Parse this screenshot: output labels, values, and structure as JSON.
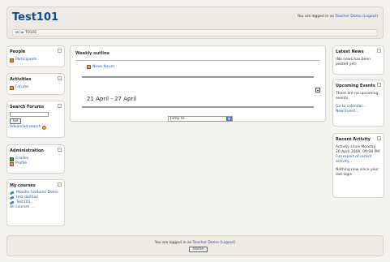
{
  "header": {
    "site_title": "Test101",
    "login_prefix": "You are logged in as ",
    "login_user": "Teacher Demo",
    "logout": "(Logout)",
    "breadcrumb_home": "ᴍᴄ",
    "breadcrumb_sep": "►",
    "breadcrumb_course": "T0101"
  },
  "people": {
    "title": "People",
    "participants": "Participants"
  },
  "activities": {
    "title": "Activities",
    "forums": "Forums"
  },
  "search_forums": {
    "title": "Search Forums",
    "go": "Go",
    "advanced": "Advanced search"
  },
  "administration": {
    "title": "Administration",
    "grades": "Grades",
    "profile": "Profile"
  },
  "my_courses": {
    "title": "My courses",
    "courses": [
      "Moodle Features Demo",
      "test damian",
      "Test101"
    ],
    "all": "All courses ..."
  },
  "main": {
    "weekly_outline": "Weekly outline",
    "news_forum": "News forum",
    "week_title": "21 April - 27 April",
    "jump_to": "Jump to..."
  },
  "latest_news": {
    "title": "Latest News",
    "text": "(No news has been posted yet)"
  },
  "upcoming_events": {
    "title": "Upcoming Events",
    "text": "There are no upcoming events",
    "goto_calendar": "Go to calendar...",
    "new_event": "New Event..."
  },
  "recent_activity": {
    "title": "Recent Activity",
    "since": "Activity since Monday, 20 April 2009, 09:08 PM",
    "full_report": "Full report of recent activity...",
    "nothing_new": "Nothing new since your last login"
  },
  "footer": {
    "login_prefix": "You are logged in as ",
    "login_user": "Teacher Demo",
    "logout": "(Logout)",
    "home": "Home"
  },
  "colors": {
    "title_blue": "#0b4d8e",
    "link_blue": "#1a56b8",
    "panel_bg": "#ffffff",
    "page_bg": "#f4f2ee"
  }
}
